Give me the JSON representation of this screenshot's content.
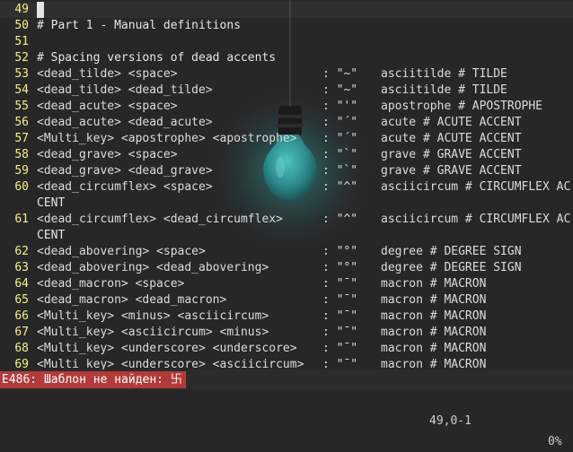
{
  "editor": {
    "lines": [
      {
        "num": "49",
        "text": "",
        "cursor": true
      },
      {
        "num": "50",
        "text": "# Part 1 - Manual definitions"
      },
      {
        "num": "51",
        "text": ""
      },
      {
        "num": "52",
        "text": "# Spacing versions of dead accents"
      },
      {
        "num": "53",
        "seq": "<dead_tilde> <space>",
        "out": ": \"~\"",
        "def": "asciitilde # TILDE"
      },
      {
        "num": "54",
        "seq": "<dead_tilde> <dead_tilde>",
        "out": ": \"~\"",
        "def": "asciitilde # TILDE"
      },
      {
        "num": "55",
        "seq": "<dead_acute> <space>",
        "out": ": \"'\"",
        "def": "apostrophe # APOSTROPHE"
      },
      {
        "num": "56",
        "seq": "<dead_acute> <dead_acute>",
        "out": ": \"´\"",
        "def": "acute # ACUTE ACCENT"
      },
      {
        "num": "57",
        "seq": "<Multi_key> <apostrophe> <apostrophe>",
        "out": ": \"´\"",
        "def": "acute # ACUTE ACCENT"
      },
      {
        "num": "58",
        "seq": "<dead_grave> <space>",
        "out": ": \"`\"",
        "def": "grave # GRAVE ACCENT"
      },
      {
        "num": "59",
        "seq": "<dead_grave> <dead_grave>",
        "out": ": \"`\"",
        "def": "grave # GRAVE ACCENT"
      },
      {
        "num": "60",
        "seq": "<dead_circumflex> <space>",
        "out": ": \"^\"",
        "def": "asciicircum # CIRCUMFLEX AC"
      },
      {
        "num": "",
        "text": "CENT"
      },
      {
        "num": "61",
        "seq": "<dead_circumflex> <dead_circumflex>",
        "out": ": \"^\"",
        "def": "asciicircum # CIRCUMFLEX AC"
      },
      {
        "num": "",
        "text": "CENT"
      },
      {
        "num": "62",
        "seq": "<dead_abovering> <space>",
        "out": ": \"°\"",
        "def": "degree # DEGREE SIGN"
      },
      {
        "num": "63",
        "seq": "<dead_abovering> <dead_abovering>",
        "out": ": \"°\"",
        "def": "degree # DEGREE SIGN"
      },
      {
        "num": "64",
        "seq": "<dead_macron> <space>",
        "out": ": \"¯\"",
        "def": "macron # MACRON"
      },
      {
        "num": "65",
        "seq": "<dead_macron> <dead_macron>",
        "out": ": \"¯\"",
        "def": "macron # MACRON"
      },
      {
        "num": "66",
        "seq": "<Multi_key> <minus> <asciicircum>",
        "out": ": \"¯\"",
        "def": "macron # MACRON"
      },
      {
        "num": "67",
        "seq": "<Multi_key> <asciicircum> <minus>",
        "out": ": \"¯\"",
        "def": "macron # MACRON"
      },
      {
        "num": "68",
        "seq": "<Multi_key> <underscore> <underscore>",
        "out": ": \"¯\"",
        "def": "macron # MACRON"
      },
      {
        "num": "69",
        "seq": "<Multi_key> <underscore> <asciicircum>",
        "out": ": \"¯\"",
        "def": "macron # MACRON"
      }
    ]
  },
  "statusbar": {
    "error": "E486: Шаблон не найден: 卐",
    "position": "49,0-1",
    "percent": "0%"
  },
  "colors": {
    "background": "#272727",
    "line_number": "#f6f08a",
    "text": "#dcdcdc",
    "error_bg": "#b23a3a",
    "bulb_glass": "#2e8d8f",
    "bulb_glow": "#3fb7b5"
  },
  "wallpaper": {
    "icon": "lightbulb-icon"
  }
}
